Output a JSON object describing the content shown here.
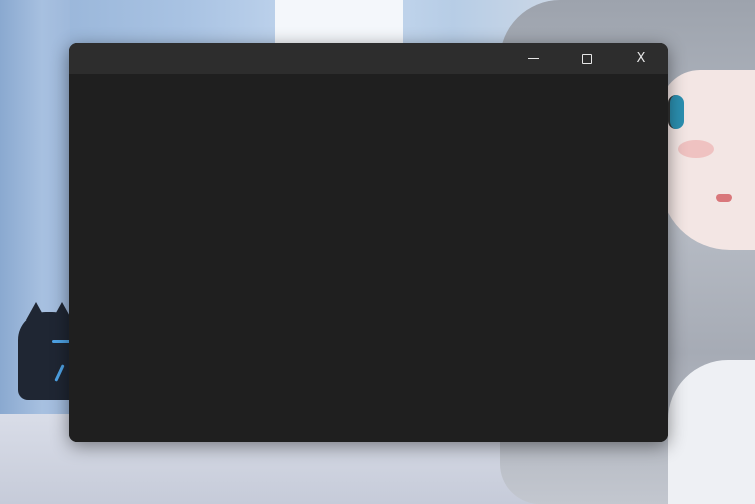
{
  "desktop": {
    "wallpaper": "anime-character-wallpaper"
  },
  "window": {
    "title": "",
    "controls": {
      "minimize_icon": "minimize-icon",
      "maximize_icon": "maximize-icon",
      "close_label": "X"
    },
    "colors": {
      "titlebar": "#2d2d2d",
      "content": "#1f1f1f",
      "glyph": "#e6e6e6"
    }
  }
}
